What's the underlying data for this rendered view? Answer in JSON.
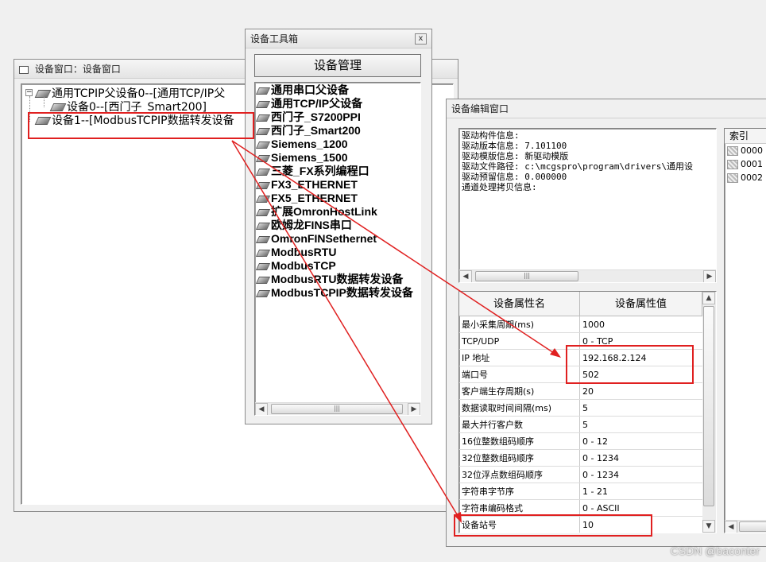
{
  "device_window": {
    "title": "设备窗口：设备窗口",
    "tree": [
      {
        "label": "通用TCPIP父设备0--[通用TCP/IP父"
      },
      {
        "label": "设备0--[西门子_Smart200]"
      },
      {
        "label": "设备1--[ModbusTCPIP数据转发设备"
      }
    ]
  },
  "toolbox": {
    "title": "设备工具箱",
    "close_symbol": "x",
    "manage_button": "设备管理",
    "items": [
      "通用串口父设备",
      "通用TCP/IP父设备",
      "西门子_S7200PPI",
      "西门子_Smart200",
      "Siemens_1200",
      "Siemens_1500",
      "三菱_FX系列编程口",
      "FX3_ETHERNET",
      "FX5_ETHERNET",
      "扩展OmronHostLink",
      "欧姆龙FINS串口",
      "OmronFINSethernet",
      "ModbusRTU",
      "ModbusTCP",
      "ModbusRTU数据转发设备",
      "ModbusTCPIP数据转发设备"
    ]
  },
  "editor": {
    "title": "设备编辑窗口",
    "info_lines": [
      "驱动构件信息:",
      "驱动版本信息: 7.101100",
      "驱动模版信息: 新驱动模版",
      "驱动文件路径: c:\\mcgspro\\program\\drivers\\通用设",
      "驱动预留信息: 0.000000",
      "通道处理拷贝信息:"
    ],
    "prop_header": {
      "name": "设备属性名",
      "value": "设备属性值"
    },
    "props": [
      {
        "name": "最小采集周期(ms)",
        "value": "1000"
      },
      {
        "name": "TCP/UDP",
        "value": "0 - TCP"
      },
      {
        "name": "IP 地址",
        "value": "192.168.2.124"
      },
      {
        "name": "端口号",
        "value": "502"
      },
      {
        "name": "客户端生存周期(s)",
        "value": "20"
      },
      {
        "name": "数据读取时间间隔(ms)",
        "value": "5"
      },
      {
        "name": "最大并行客户数",
        "value": "5"
      },
      {
        "name": "16位整数组码顺序",
        "value": "0 - 12"
      },
      {
        "name": "32位整数组码顺序",
        "value": "0 - 1234"
      },
      {
        "name": "32位浮点数组码顺序",
        "value": "0 - 1234"
      },
      {
        "name": "字符串字节序",
        "value": "1 - 21"
      },
      {
        "name": "字符串编码格式",
        "value": "0 - ASCII"
      },
      {
        "name": "设备站号",
        "value": "10"
      }
    ],
    "index_header": "索引",
    "index_items": [
      "0000",
      "0001",
      "0002"
    ]
  },
  "watermark": "CSDN @baconter",
  "colors": {
    "annotation": "#e02020"
  }
}
